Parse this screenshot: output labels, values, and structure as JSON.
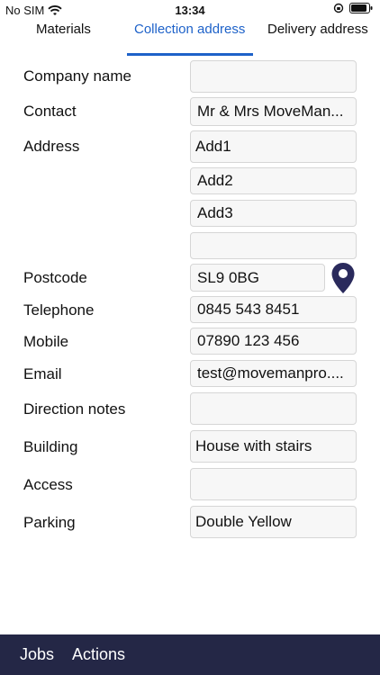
{
  "status_bar": {
    "carrier": "No SIM",
    "time": "13:34"
  },
  "tabs": [
    {
      "label": "Materials",
      "active": false
    },
    {
      "label": "Collection address",
      "active": true
    },
    {
      "label": "Delivery address",
      "active": false
    }
  ],
  "form": {
    "company_name": {
      "label": "Company name",
      "value": ""
    },
    "contact": {
      "label": "Contact",
      "value": "Mr & Mrs MoveMan..."
    },
    "address": {
      "label": "Address",
      "lines": [
        "Add1",
        "Add2",
        "Add3",
        ""
      ]
    },
    "postcode": {
      "label": "Postcode",
      "value": "SL9 0BG"
    },
    "telephone": {
      "label": "Telephone",
      "value": "0845 543 8451"
    },
    "mobile": {
      "label": "Mobile",
      "value": "07890 123 456"
    },
    "email": {
      "label": "Email",
      "value": "test@movemanpro...."
    },
    "direction_notes": {
      "label": "Direction notes",
      "value": ""
    },
    "building": {
      "label": "Building",
      "value": "House with stairs"
    },
    "access": {
      "label": "Access",
      "value": ""
    },
    "parking": {
      "label": "Parking",
      "value": "Double Yellow"
    }
  },
  "bottom_bar": {
    "jobs": "Jobs",
    "actions": "Actions"
  },
  "colors": {
    "accent": "#1e62c9",
    "bottom_bar": "#242746",
    "pin": "#2a2a5c"
  },
  "icons": {
    "wifi": "wifi-icon",
    "lock": "orientation-lock-icon",
    "battery": "battery-icon",
    "pin": "map-pin-icon"
  }
}
